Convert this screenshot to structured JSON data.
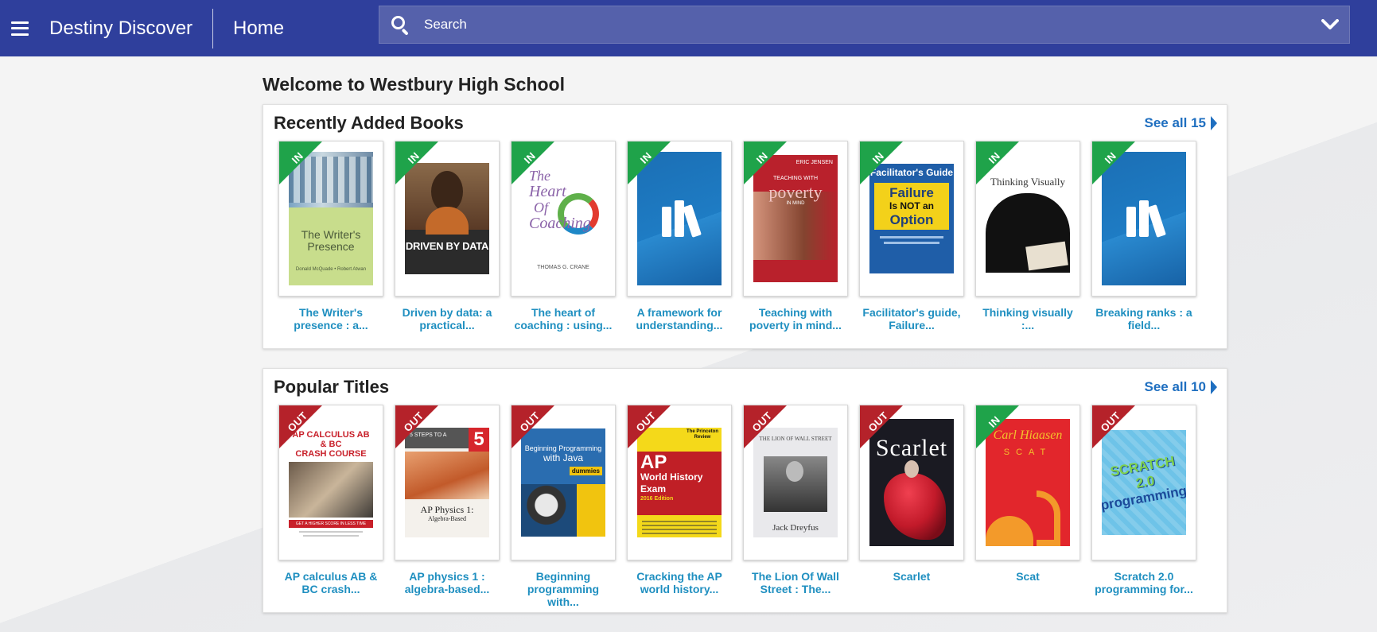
{
  "header": {
    "brand": "Destiny Discover",
    "page": "Home",
    "search_placeholder": "Search"
  },
  "welcome": "Welcome to Westbury High School",
  "colors": {
    "header_bg": "#2f3f9c",
    "search_bg": "#5561ab",
    "link": "#1f8fc0",
    "see_all": "#1f6fc0",
    "status_in": "#1fa34a",
    "status_out": "#b5222a"
  },
  "recent": {
    "title": "Recently Added Books",
    "see_all": "See all 15",
    "books": [
      {
        "title": "The Writer's presence : a...",
        "status": "IN",
        "cover_text": [
          "The Writer's",
          "Presence",
          "Donald McQuade • Robert Atwan"
        ]
      },
      {
        "title": "Driven by data: a practical...",
        "status": "IN",
        "cover_text": [
          "DRIVEN BY DATA"
        ]
      },
      {
        "title": "The heart of coaching : using...",
        "status": "IN",
        "cover_text": [
          "The",
          "Heart",
          "Of",
          "Coaching",
          "THOMAS G. CRANE"
        ]
      },
      {
        "title": "A framework for understanding...",
        "status": "IN",
        "cover_text": []
      },
      {
        "title": "Teaching with poverty in mind...",
        "status": "IN",
        "cover_text": [
          "ERIC JENSEN",
          "TEACHING WITH",
          "poverty",
          "IN MIND"
        ]
      },
      {
        "title": "Facilitator's guide, Failure...",
        "status": "IN",
        "cover_text": [
          "Facilitator's Guide",
          "Failure",
          "Is NOT an",
          "Option"
        ]
      },
      {
        "title": "Thinking visually :...",
        "status": "IN",
        "cover_text": [
          "Thinking Visually"
        ]
      },
      {
        "title": "Breaking ranks : a field...",
        "status": "IN",
        "cover_text": []
      }
    ]
  },
  "popular": {
    "title": "Popular Titles",
    "see_all": "See all 10",
    "books": [
      {
        "title": "AP calculus AB & BC crash...",
        "status": "OUT",
        "cover_text": [
          "AP CALCULUS AB & BC",
          "CRASH COURSE",
          "GET A HIGHER SCORE IN LESS TIME"
        ]
      },
      {
        "title": "AP physics 1 : algebra-based...",
        "status": "OUT",
        "cover_text": [
          "5 STEPS TO A",
          "5",
          "AP Physics 1:",
          "Algebra-Based"
        ]
      },
      {
        "title": "Beginning programming with...",
        "status": "OUT",
        "cover_text": [
          "Beginning Programming",
          "with Java",
          "dummies"
        ]
      },
      {
        "title": "Cracking the AP world history...",
        "status": "OUT",
        "cover_text": [
          "The Princeton Review",
          "AP",
          "World History",
          "Exam",
          "2016 Edition"
        ]
      },
      {
        "title": "The Lion Of Wall Street : The...",
        "status": "OUT",
        "cover_text": [
          "THE LION OF WALL STREET",
          "Jack Dreyfus"
        ]
      },
      {
        "title": "Scarlet",
        "status": "OUT",
        "cover_text": [
          "Scarlet"
        ]
      },
      {
        "title": "Scat",
        "status": "IN",
        "cover_text": [
          "Carl Hiaasen",
          "SCAT"
        ]
      },
      {
        "title": "Scratch 2.0 programming for...",
        "status": "OUT",
        "cover_text": [
          "SCRATCH 2.0",
          "programming"
        ]
      }
    ]
  }
}
